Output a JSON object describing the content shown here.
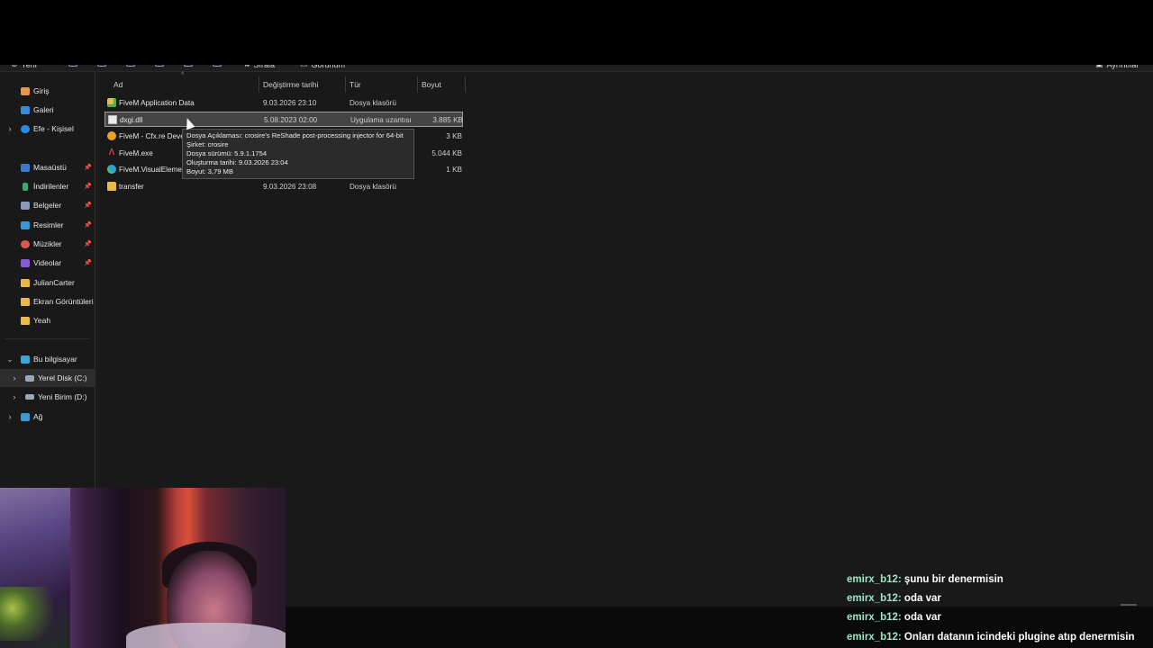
{
  "toolbar": {
    "new_label": "Yeni",
    "sort_label": "Sırala",
    "view_label": "Görünüm",
    "details_label": "Ayrıntılar"
  },
  "nav": {
    "items": [
      {
        "label": "Giriş",
        "icon": "home-icon"
      },
      {
        "label": "Galeri",
        "icon": "gallery-icon"
      },
      {
        "label": "Efe - Kişisel",
        "icon": "cloud-icon"
      },
      {
        "label": "Masaüstü",
        "icon": "desktop-icon"
      },
      {
        "label": "İndirilenler",
        "icon": "download-icon"
      },
      {
        "label": "Belgeler",
        "icon": "documents-icon"
      },
      {
        "label": "Resimler",
        "icon": "pictures-icon"
      },
      {
        "label": "Müzikler",
        "icon": "music-icon"
      },
      {
        "label": "Videolar",
        "icon": "videos-icon"
      },
      {
        "label": "JulianCarter",
        "icon": "folder-icon"
      },
      {
        "label": "Ekran Görüntüleri",
        "icon": "folder-icon"
      },
      {
        "label": "Yeah",
        "icon": "folder-icon"
      },
      {
        "label": "Bu bilgisayar",
        "icon": "pc-icon"
      },
      {
        "label": "Yerel Disk (C:)",
        "icon": "drive-icon"
      },
      {
        "label": "Yeni Birim (D:)",
        "icon": "drive-icon"
      },
      {
        "label": "Ağ",
        "icon": "network-icon"
      }
    ]
  },
  "columns": {
    "name": "Ad",
    "date": "Değiştirme tarihi",
    "type": "Tür",
    "size": "Boyut"
  },
  "files": [
    {
      "name": "FiveM Application Data",
      "date": "9.03.2026 23:10",
      "type": "Dosya klasörü",
      "size": "",
      "icon": "folder-icon"
    },
    {
      "name": "dxgi.dll",
      "date": "5.08.2023 02:00",
      "type": "Uygulama uzantısı",
      "size": "3.885 KB",
      "icon": "dll-file-icon"
    },
    {
      "name": "FiveM - Cfx.re Devel",
      "date": "",
      "type": "",
      "size": "3 KB",
      "icon": "cfx-shortcut-icon"
    },
    {
      "name": "FiveM.exe",
      "date": "",
      "type": "",
      "size": "5.044 KB",
      "icon": "fivem-exe-icon"
    },
    {
      "name": "FiveM.VisualElement",
      "date": "",
      "type": "",
      "size": "1 KB",
      "icon": "edge-file-icon"
    },
    {
      "name": "transfer",
      "date": "9.03.2026 23:08",
      "type": "Dosya klasörü",
      "size": "",
      "icon": "folder-icon"
    }
  ],
  "tooltip": {
    "line1": "Dosya Açıklaması: crosire's ReShade post-processing injector for 64-bit",
    "line2": "Şirket: crosire",
    "line3": "Dosya sürümü: 5.9.1.1754",
    "line4": "Oluşturma tarihi: 9.03.2026 23:04",
    "line5": "Boyut: 3,79 MB"
  },
  "chat": [
    {
      "user": "emirx_b12:",
      "message": " şunu bir denermisin"
    },
    {
      "user": "emirx_b12:",
      "message": " oda var"
    },
    {
      "user": "emirx_b12:",
      "message": " oda var"
    },
    {
      "user": "emirx_b12:",
      "message": " Onları datanın icindeki plugine atıp denermisin"
    }
  ],
  "colors": {
    "explorer_bg": "#191919",
    "selection": "#444444",
    "chat_user": "#9ee6c8"
  }
}
